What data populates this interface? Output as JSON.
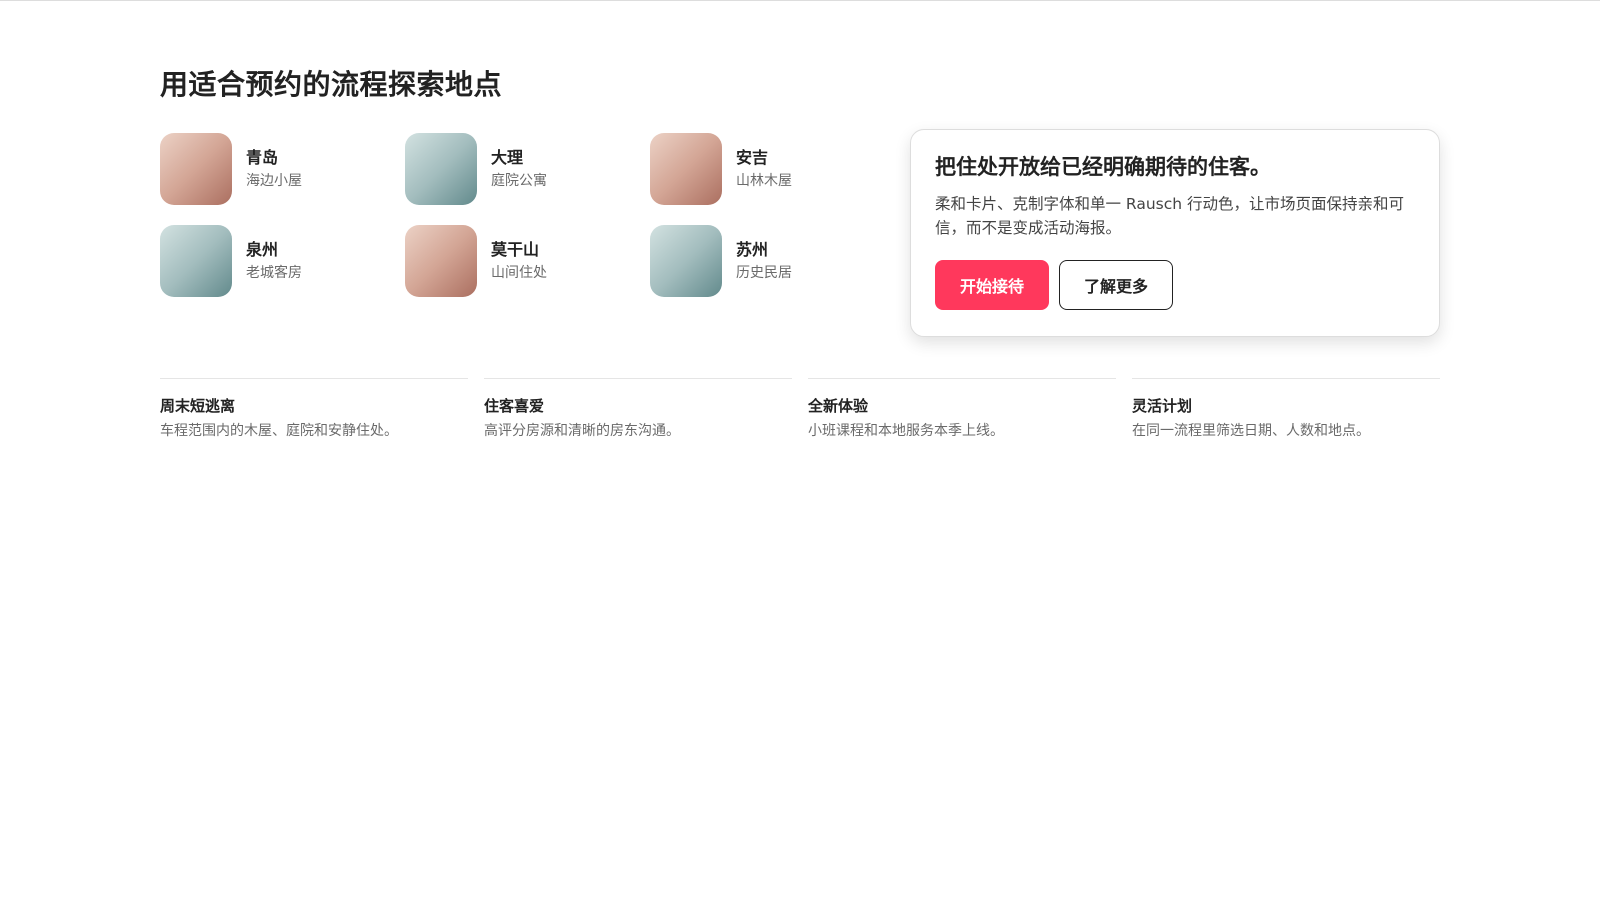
{
  "section": {
    "title": "用适合预约的流程探索地点"
  },
  "destinations": [
    {
      "name": "青岛",
      "subtitle": "海边小屋",
      "thumb_color": "#c39282"
    },
    {
      "name": "大理",
      "subtitle": "庭院公寓",
      "thumb_color": "#8fb0b1"
    },
    {
      "name": "安吉",
      "subtitle": "山林木屋",
      "thumb_color": "#c39282"
    },
    {
      "name": "泉州",
      "subtitle": "老城客房",
      "thumb_color": "#8fb0b1"
    },
    {
      "name": "莫干山",
      "subtitle": "山间住处",
      "thumb_color": "#c39282"
    },
    {
      "name": "苏州",
      "subtitle": "历史民居",
      "thumb_color": "#8fb0b1"
    }
  ],
  "host_card": {
    "title": "把住处开放给已经明确期待的住客。",
    "body": "柔和卡片、克制字体和单一 Rausch 行动色，让市场页面保持亲和可信，而不是变成活动海报。",
    "primary_button": "开始接待",
    "secondary_button": "了解更多",
    "accent_color": "#ff385c"
  },
  "features": [
    {
      "title": "周末短逃离",
      "description": "车程范围内的木屋、庭院和安静住处。"
    },
    {
      "title": "住客喜爱",
      "description": "高评分房源和清晰的房东沟通。"
    },
    {
      "title": "全新体验",
      "description": "小班课程和本地服务本季上线。"
    },
    {
      "title": "灵活计划",
      "description": "在同一流程里筛选日期、人数和地点。"
    }
  ]
}
